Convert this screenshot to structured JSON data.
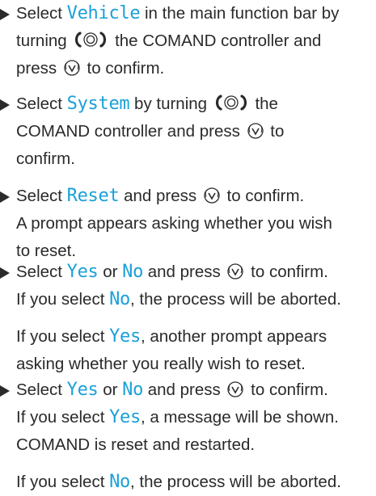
{
  "steps": [
    {
      "lines": [
        [
          "Select ",
          {
            "kw": "Vehicle"
          },
          " in the main function bar by"
        ],
        [
          "turning ",
          {
            "icon": "rotate"
          },
          " the COMAND controller and"
        ],
        [
          "press ",
          {
            "icon": "press"
          },
          " to confirm."
        ]
      ]
    },
    {
      "lines": [
        [
          "Select ",
          {
            "kw": "System"
          },
          " by turning ",
          {
            "icon": "rotate"
          },
          " the"
        ],
        [
          "COMAND controller and press ",
          {
            "icon": "press"
          },
          " to"
        ],
        [
          "confirm."
        ]
      ]
    },
    {
      "lines": [
        [
          "Select ",
          {
            "kw": "Reset"
          },
          " and press ",
          {
            "icon": "press"
          },
          " to confirm."
        ],
        [
          "A prompt appears asking whether you wish"
        ],
        [
          "to reset."
        ]
      ]
    },
    {
      "lines": [
        [
          "Select ",
          {
            "kw": "Yes"
          },
          " or ",
          {
            "kw": "No"
          },
          " and press ",
          {
            "icon": "press"
          },
          " to confirm."
        ],
        [
          "If you select ",
          {
            "kw": "No"
          },
          ", the process will be aborted."
        ],
        [
          "If you select ",
          {
            "kw": "Yes"
          },
          ", another prompt appears"
        ],
        [
          "asking whether you really wish to reset."
        ]
      ]
    },
    {
      "lines": [
        [
          "Select ",
          {
            "kw": "Yes"
          },
          " or ",
          {
            "kw": "No"
          },
          " and press ",
          {
            "icon": "press"
          },
          " to confirm."
        ],
        [
          "If you select ",
          {
            "kw": "Yes"
          },
          ", a message will be shown."
        ],
        [
          "COMAND is reset and restarted."
        ],
        [
          "If you select ",
          {
            "kw": "No"
          },
          ", the process will be aborted."
        ]
      ]
    }
  ],
  "icons": {
    "rotate": "rotate-controller-icon",
    "press": "press-controller-icon"
  },
  "colors": {
    "keyword": "#1aa0d8",
    "text": "#2a2a2a"
  }
}
